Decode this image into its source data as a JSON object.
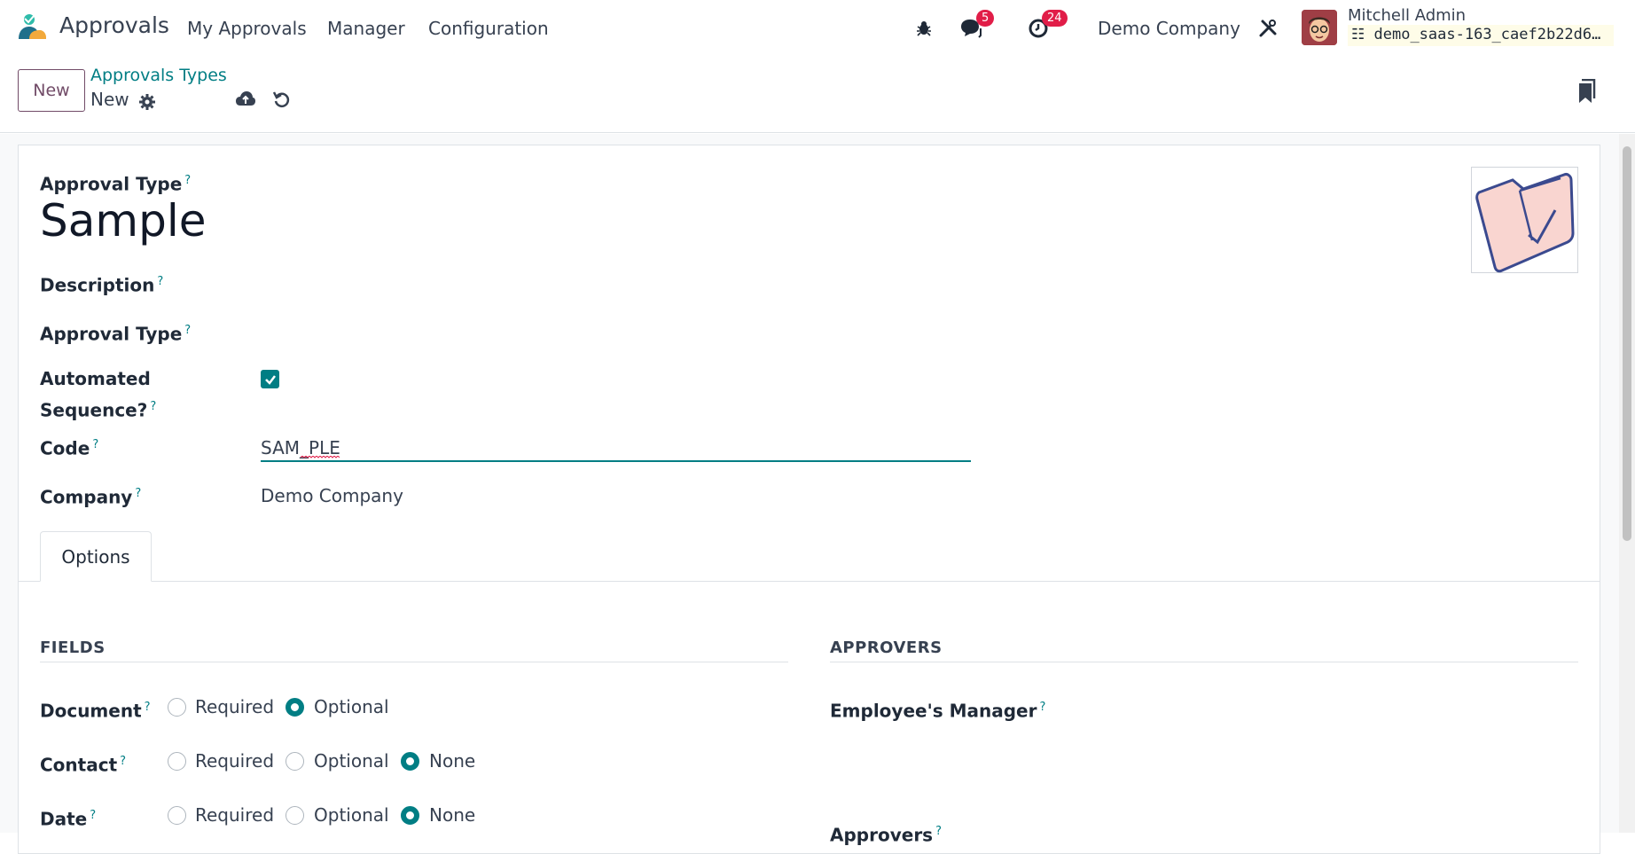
{
  "topbar": {
    "app_name": "Approvals",
    "menu": [
      "My Approvals",
      "Manager",
      "Configuration"
    ],
    "messages_count": "5",
    "activities_count": "24",
    "company": "Demo Company",
    "user_name": "Mitchell Admin",
    "database": "demo_saas-163_caef2b22d6…"
  },
  "control": {
    "new_label": "New",
    "breadcrumb_parent": "Approvals Types",
    "breadcrumb_current": "New"
  },
  "form": {
    "approval_type_label": "Approval Type",
    "name_value": "Sample",
    "description_label": "Description",
    "approval_type2_label": "Approval Type",
    "automated_sequence_label_1": "Automated",
    "automated_sequence_label_2": "Sequence?",
    "automated_sequence_checked": true,
    "code_label": "Code",
    "code_value": "SAM_PLE",
    "company_label": "Company",
    "company_value": "Demo Company",
    "help_mark": "?"
  },
  "tabs": {
    "options_label": "Options"
  },
  "fields_section": {
    "title": "FIELDS",
    "rows": [
      {
        "label": "Document",
        "options": [
          "Required",
          "Optional"
        ],
        "selected": "Optional"
      },
      {
        "label": "Contact",
        "options": [
          "Required",
          "Optional",
          "None"
        ],
        "selected": "None"
      },
      {
        "label": "Date",
        "options": [
          "Required",
          "Optional",
          "None"
        ],
        "selected": "None"
      }
    ]
  },
  "approvers_section": {
    "title": "APPROVERS",
    "employee_manager_label": "Employee's Manager",
    "approvers_label": "Approvers"
  },
  "colors": {
    "accent": "#017e84",
    "brand": "#714b67",
    "badge": "#e11d48"
  }
}
